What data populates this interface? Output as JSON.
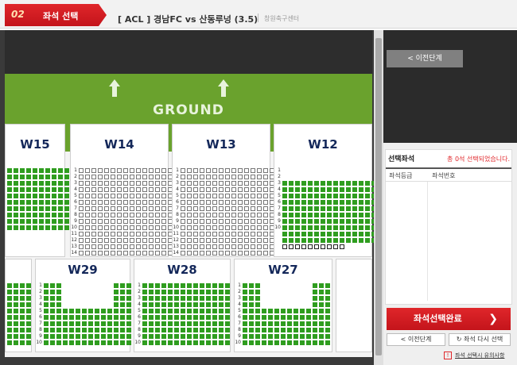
{
  "header": {
    "step_number": "02",
    "step_label": "좌석 선택",
    "event_title": "[ ACL ] 경남FC vs 산동루넝 (3.5)",
    "venue": "창원축구센터"
  },
  "map": {
    "ground_label": "GROUND",
    "blocks_top": [
      {
        "name": "W15",
        "rows": 10
      },
      {
        "name": "W14",
        "rows": 14
      },
      {
        "name": "W13",
        "rows": 14
      },
      {
        "name": "W12",
        "rows": 13
      }
    ],
    "blocks_bottom": [
      {
        "name": "",
        "rows": 10
      },
      {
        "name": "W29",
        "rows": 10
      },
      {
        "name": "W28",
        "rows": 10
      },
      {
        "name": "W27",
        "rows": 10
      }
    ],
    "row_numbers_14": [
      "1",
      "2",
      "3",
      "4",
      "5",
      "6",
      "7",
      "8",
      "9",
      "10",
      "11",
      "12",
      "13",
      "14"
    ],
    "row_numbers_10": [
      "1",
      "2",
      "3",
      "4",
      "5",
      "6",
      "7",
      "8",
      "9",
      "10"
    ]
  },
  "panel": {
    "prev_step_top": "이전단계",
    "selected_title": "선택좌석",
    "selected_count_prefix": "총 ",
    "selected_count_value": "0",
    "selected_count_suffix": "석 선택되었습니다.",
    "col_grade": "좌석등급",
    "col_seat_no": "좌석번호",
    "complete_button": "좌석선택완료",
    "prev_step_bottom": "이전단계",
    "reselect": "좌석 다시 선택",
    "caution": "좌석 선택시 유의사항"
  },
  "colors": {
    "accent_red": "#e0262a",
    "seat_taken": "#2f9d1f",
    "ground": "#6aa22d",
    "block_title": "#14285a"
  }
}
